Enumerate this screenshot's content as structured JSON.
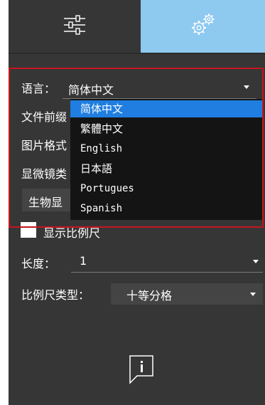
{
  "tabs": [
    {
      "icon": "sliders-icon",
      "active": false
    },
    {
      "icon": "gears-icon",
      "active": true
    }
  ],
  "settings": {
    "language_label": "语言：",
    "language_value": "简体中文",
    "file_prefix_label": "文件前缀",
    "image_format_label": "图片格式",
    "microscope_type_label": "显微镜类",
    "microscope_value": "生物显",
    "show_scale_label": "显示比例尺",
    "length_label": "长度：",
    "length_value": "1",
    "scale_type_label": "比例尺类型：",
    "scale_type_value": "十等分格"
  },
  "language_dropdown": {
    "options": [
      "简体中文",
      "繁體中文",
      "English",
      "日本語",
      "Portugues",
      "Spanish"
    ],
    "selected_index": 0
  },
  "colors": {
    "panel_bg": "#363636",
    "active_tab": "#8ec9f0",
    "selected_option": "#1f7ee0",
    "dropdown_bg": "#141414",
    "highlight_border": "#c4161c"
  }
}
